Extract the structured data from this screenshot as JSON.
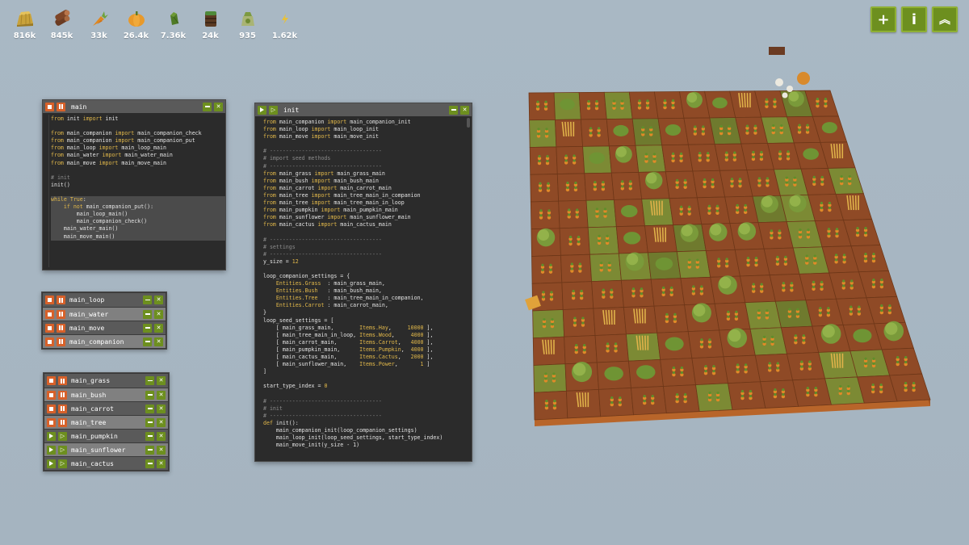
{
  "resources": [
    {
      "icon": "hay-icon",
      "value": "816k"
    },
    {
      "icon": "wood-icon",
      "value": "845k"
    },
    {
      "icon": "carrot-icon",
      "value": "33k"
    },
    {
      "icon": "pumpkin-icon",
      "value": "26.4k"
    },
    {
      "icon": "cactus-icon",
      "value": "7.36k"
    },
    {
      "icon": "water-tank-icon",
      "value": "24k"
    },
    {
      "icon": "fertilizer-icon",
      "value": "935"
    },
    {
      "icon": "power-icon",
      "value": "1.62k"
    }
  ],
  "top_buttons": {
    "add": "+",
    "info": "i",
    "collapse": "︽"
  },
  "colors": {
    "accent_green": "#6d8f1f",
    "accent_orange": "#d7612a",
    "code_keyword": "#e2b84a",
    "code_comment": "#8a8a8a"
  },
  "main_window": {
    "title": "main",
    "lines": [
      "from init import init",
      "",
      "from main_companion import main_companion_check",
      "from main_companion import main_companion_put",
      "from main_loop import main_loop_main",
      "from main_water import main_water_main",
      "from main_move import main_move_main",
      "",
      "# init",
      "init()",
      "",
      "while True:",
      "    if not main_companion_put():",
      "        main_loop_main()",
      "        main_companion_check()",
      "    main_water_main()",
      "    main_move_main()"
    ]
  },
  "init_window": {
    "title": "init",
    "lines": [
      "from main_companion import main_companion_init",
      "from main_loop import main_loop_init",
      "from main_move import main_move_init",
      "",
      "# -----------------------------------",
      "# import seed methods",
      "# -----------------------------------",
      "from main_grass import main_grass_main",
      "from main_bush import main_bush_main",
      "from main_carrot import main_carrot_main",
      "from main_tree import main_tree_main_in_companion",
      "from main_tree import main_tree_main_in_loop",
      "from main_pumpkin import main_pumpkin_main",
      "from main_sunflower import main_sunflower_main",
      "from main_cactus import main_cactus_main",
      "",
      "# -----------------------------------",
      "# settings",
      "# -----------------------------------",
      "y_size = 12",
      "",
      "loop_companion_settings = {",
      "    Entities.Grass  : main_grass_main,",
      "    Entities.Bush   : main_bush_main,",
      "    Entities.Tree   : main_tree_main_in_companion,",
      "    Entities.Carrot : main_carrot_main,",
      "}",
      "loop_seed_settings = [",
      "    [ main_grass_main,        Items.Hay,     10000 ],",
      "    [ main_tree_main_in_loop, Items.Wood,     4000 ],",
      "    [ main_carrot_main,       Items.Carrot,   4000 ],",
      "    [ main_pumpkin_main,      Items.Pumpkin,  4000 ],",
      "    [ main_cactus_main,       Items.Cactus,   2000 ],",
      "    [ main_sunflower_main,    Items.Power,       1 ]",
      "]",
      "",
      "start_type_index = 0",
      "",
      "# -----------------------------------",
      "# init",
      "# -----------------------------------",
      "def init():",
      "    main_companion_init(loop_companion_settings)",
      "    main_loop_init(loop_seed_settings, start_type_index)",
      "    main_move_init(y_size - 1)"
    ]
  },
  "script_list_1": [
    {
      "name": "main_loop",
      "state": "running"
    },
    {
      "name": "main_water",
      "state": "running"
    },
    {
      "name": "main_move",
      "state": "running"
    },
    {
      "name": "main_companion",
      "state": "running"
    }
  ],
  "script_list_2": [
    {
      "name": "main_grass",
      "state": "running"
    },
    {
      "name": "main_bush",
      "state": "running"
    },
    {
      "name": "main_carrot",
      "state": "running"
    },
    {
      "name": "main_tree",
      "state": "running"
    },
    {
      "name": "main_pumpkin",
      "state": "stopped"
    },
    {
      "name": "main_sunflower",
      "state": "stopped"
    },
    {
      "name": "main_cactus",
      "state": "stopped"
    }
  ],
  "farm": {
    "grid_size": 12
  }
}
